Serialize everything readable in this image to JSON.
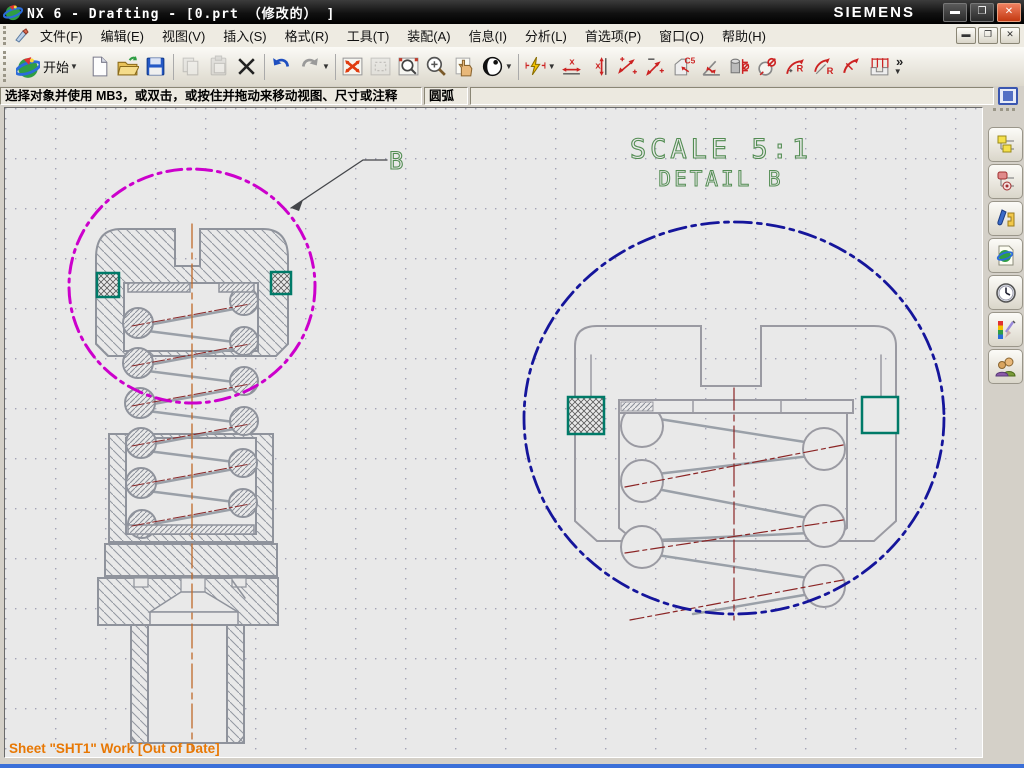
{
  "window": {
    "title": "NX 6 - Drafting - [0.prt （修改的） ]",
    "brand": "SIEMENS",
    "controls": [
      "minimize-icon",
      "restore-icon",
      "close-icon"
    ]
  },
  "menubar": {
    "items": [
      "文件(F)",
      "编辑(E)",
      "视图(V)",
      "插入(S)",
      "格式(R)",
      "工具(T)",
      "装配(A)",
      "信息(I)",
      "分析(L)",
      "首选项(P)",
      "窗口(O)",
      "帮助(H)"
    ],
    "mdi_controls": [
      "minimize-icon",
      "restore-icon",
      "close-icon"
    ]
  },
  "toolbar": {
    "start_label": "开始",
    "overflow_label": "»",
    "icons": [
      "nx-logo",
      "new-part",
      "open",
      "save",
      "copy",
      "paste",
      "delete",
      "undo",
      "redo",
      "fit-view",
      "zoom-region",
      "zoom-box",
      "zoom-in-out",
      "pan",
      "display-mode",
      "inferred-dimension",
      "horizontal-dimension",
      "vertical-dimension",
      "parallel-dimension",
      "perpendicular-dimension",
      "chamfer-dimension",
      "angular-dimension",
      "cylindrical-dimension",
      "hole-dimension",
      "radius-dimension",
      "radius-center-dimension",
      "arc-length-dimension",
      "ordinate-dimension"
    ],
    "disabled_icons": [
      "copy",
      "paste",
      "zoom-region"
    ]
  },
  "prompt": {
    "message": "选择对象并使用 MB3，或双击，或按住并拖动来移动视图、尺寸或注释",
    "cue": "圆弧"
  },
  "sidebar": {
    "icons": [
      "assembly-navigator",
      "constraint-navigator",
      "part-navigator",
      "reuse-library",
      "history",
      "palettes",
      "roles"
    ]
  },
  "drawing": {
    "scale_label": "SCALE 5:1",
    "detail_label": "DETAIL B",
    "balloon_label": "B",
    "sheet_status": "Sheet \"SHT1\" Work [Out of Date]"
  },
  "colors": {
    "detail_circle_left": "#cc00cc",
    "detail_circle_right": "#15159b",
    "highlight_teal": "#007a68",
    "cad_text_green": "#538d53",
    "status_orange": "#e87804",
    "centerline_red": "#8b2525",
    "centerline_orange": "#c06a2a",
    "geometry_gray": "#8f939c"
  }
}
